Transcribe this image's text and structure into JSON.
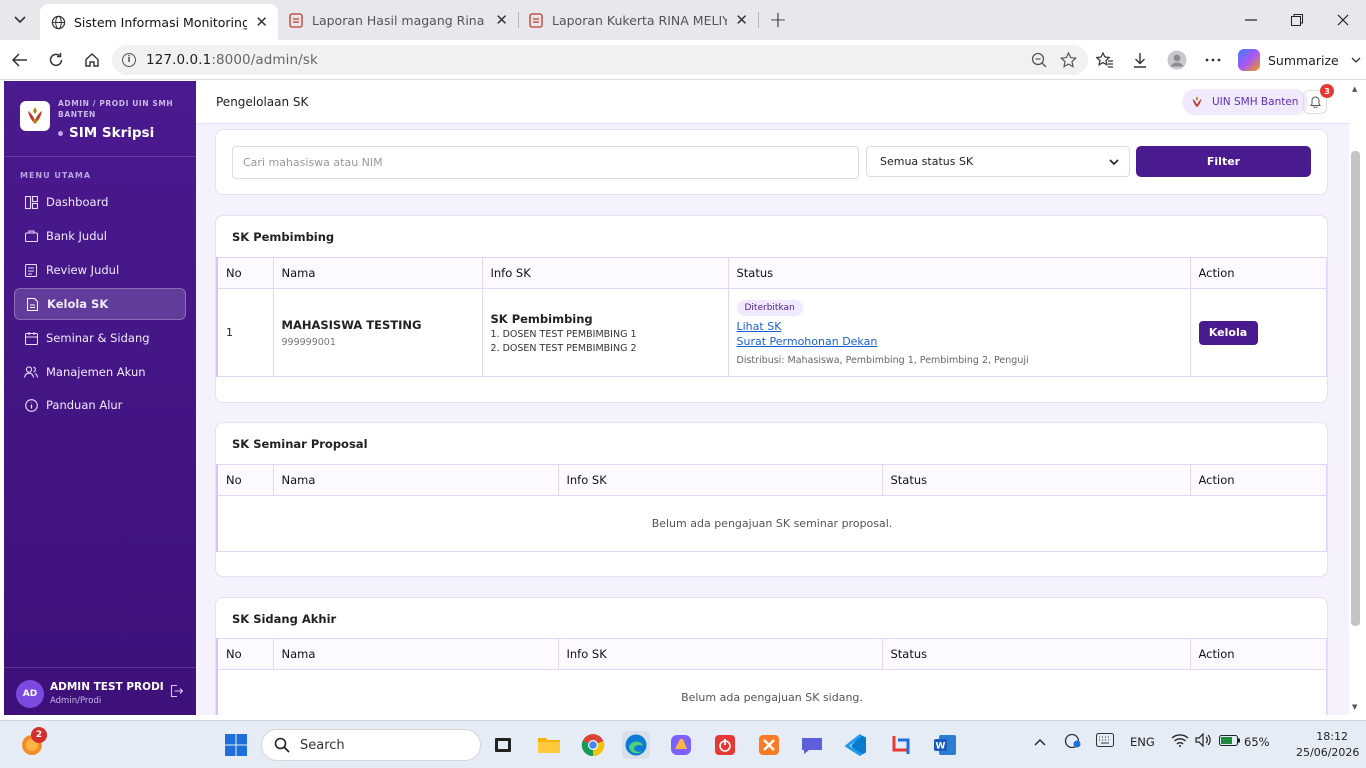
{
  "browser": {
    "tabs": [
      {
        "title": "Sistem Informasi Monitoring Skripsi",
        "active": true
      },
      {
        "title": "Laporan Hasil magang Rina Meliyana",
        "active": false
      },
      {
        "title": "Laporan Kukerta RINA MELIYANA.pdf",
        "active": false
      }
    ],
    "url_host": "127.0.0.1",
    "url_rest": ":8000/admin/sk",
    "summarize_label": "Summarize"
  },
  "sidebar": {
    "org_label": "ADMIN / PRODI UIN SMH BANTEN",
    "app_title": "SIM Skripsi",
    "menu_heading": "MENU UTAMA",
    "items": [
      {
        "label": "Dashboard",
        "icon": "dashboard-icon"
      },
      {
        "label": "Bank Judul",
        "icon": "briefcase-icon"
      },
      {
        "label": "Review Judul",
        "icon": "document-icon"
      },
      {
        "label": "Kelola SK",
        "icon": "file-icon",
        "active": true
      },
      {
        "label": "Seminar & Sidang",
        "icon": "calendar-icon"
      },
      {
        "label": "Manajemen Akun",
        "icon": "users-icon"
      },
      {
        "label": "Panduan Alur",
        "icon": "info-icon"
      }
    ],
    "user": {
      "initials": "AD",
      "name": "ADMIN TEST PRODI",
      "role": "Admin/Prodi"
    }
  },
  "header": {
    "page_title": "Pengelolaan SK",
    "org_chip": "UIN SMH Banten",
    "notification_count": "3"
  },
  "filters": {
    "search_placeholder": "Cari mahasiswa atau NIM",
    "status_selected": "Semua status SK",
    "filter_label": "Filter"
  },
  "sk_pembimbing": {
    "title": "SK Pembimbing",
    "columns": [
      "No",
      "Nama",
      "Info SK",
      "Status",
      "Action"
    ],
    "row": {
      "no": "1",
      "name": "MAHASISWA TESTING",
      "nim": "999999001",
      "sk_title": "SK Pembimbing",
      "sk_line1": "1. DOSEN TEST PEMBIMBING 1",
      "sk_line2": "2. DOSEN TEST PEMBIMBING 2",
      "status_badge": "Diterbitkan",
      "link1": "Lihat SK",
      "link2": "Surat Permohonan Dekan",
      "distribution": "Distribusi: Mahasiswa, Pembimbing 1, Pembimbing 2, Penguji",
      "action": "Kelola"
    }
  },
  "sk_seminar": {
    "title": "SK Seminar Proposal",
    "columns": [
      "No",
      "Nama",
      "Info SK",
      "Status",
      "Action"
    ],
    "empty": "Belum ada pengajuan SK seminar proposal."
  },
  "sk_sidang": {
    "title": "SK Sidang Akhir",
    "columns": [
      "No",
      "Nama",
      "Info SK",
      "Status",
      "Action"
    ],
    "empty": "Belum ada pengajuan SK sidang."
  },
  "taskbar": {
    "search_label": "Search",
    "weather_badge": "2",
    "language": "ENG",
    "battery": "65%",
    "time": "18:12",
    "date": "25/06/2026"
  },
  "colors": {
    "brand_purple": "#4a1a8f",
    "link_blue": "#1d5fd1",
    "badge_red": "#e53935"
  }
}
